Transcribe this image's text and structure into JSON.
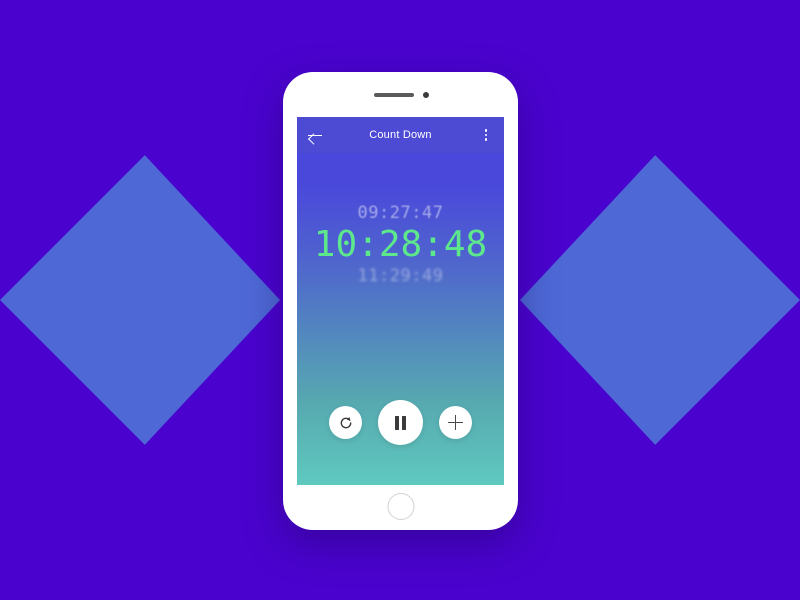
{
  "background": {
    "base_color": "#4A03CE",
    "accent_color": "#4E68D6",
    "shape": "opposing-chevrons"
  },
  "device": {
    "name": "smartphone-mockup",
    "speaker": "speaker-grille",
    "camera": "front-camera",
    "home_button": "home-button"
  },
  "appbar": {
    "title": "Count Down",
    "back_icon": "back-arrow-icon",
    "menu_icon": "overflow-menu-icon",
    "background_color": "#4D4BD4"
  },
  "timer": {
    "previous": "09:27:47",
    "current": "10:28:48",
    "next": "11:29:49",
    "current_color": "#5DE88C"
  },
  "controls": {
    "reset": {
      "label": "Reset",
      "icon": "reset-icon"
    },
    "pause": {
      "label": "Pause",
      "icon": "pause-icon"
    },
    "add": {
      "label": "Add",
      "icon": "plus-icon"
    }
  },
  "screen": {
    "gradient_top": "#4A46DC",
    "gradient_bottom": "#5FC9BF"
  }
}
